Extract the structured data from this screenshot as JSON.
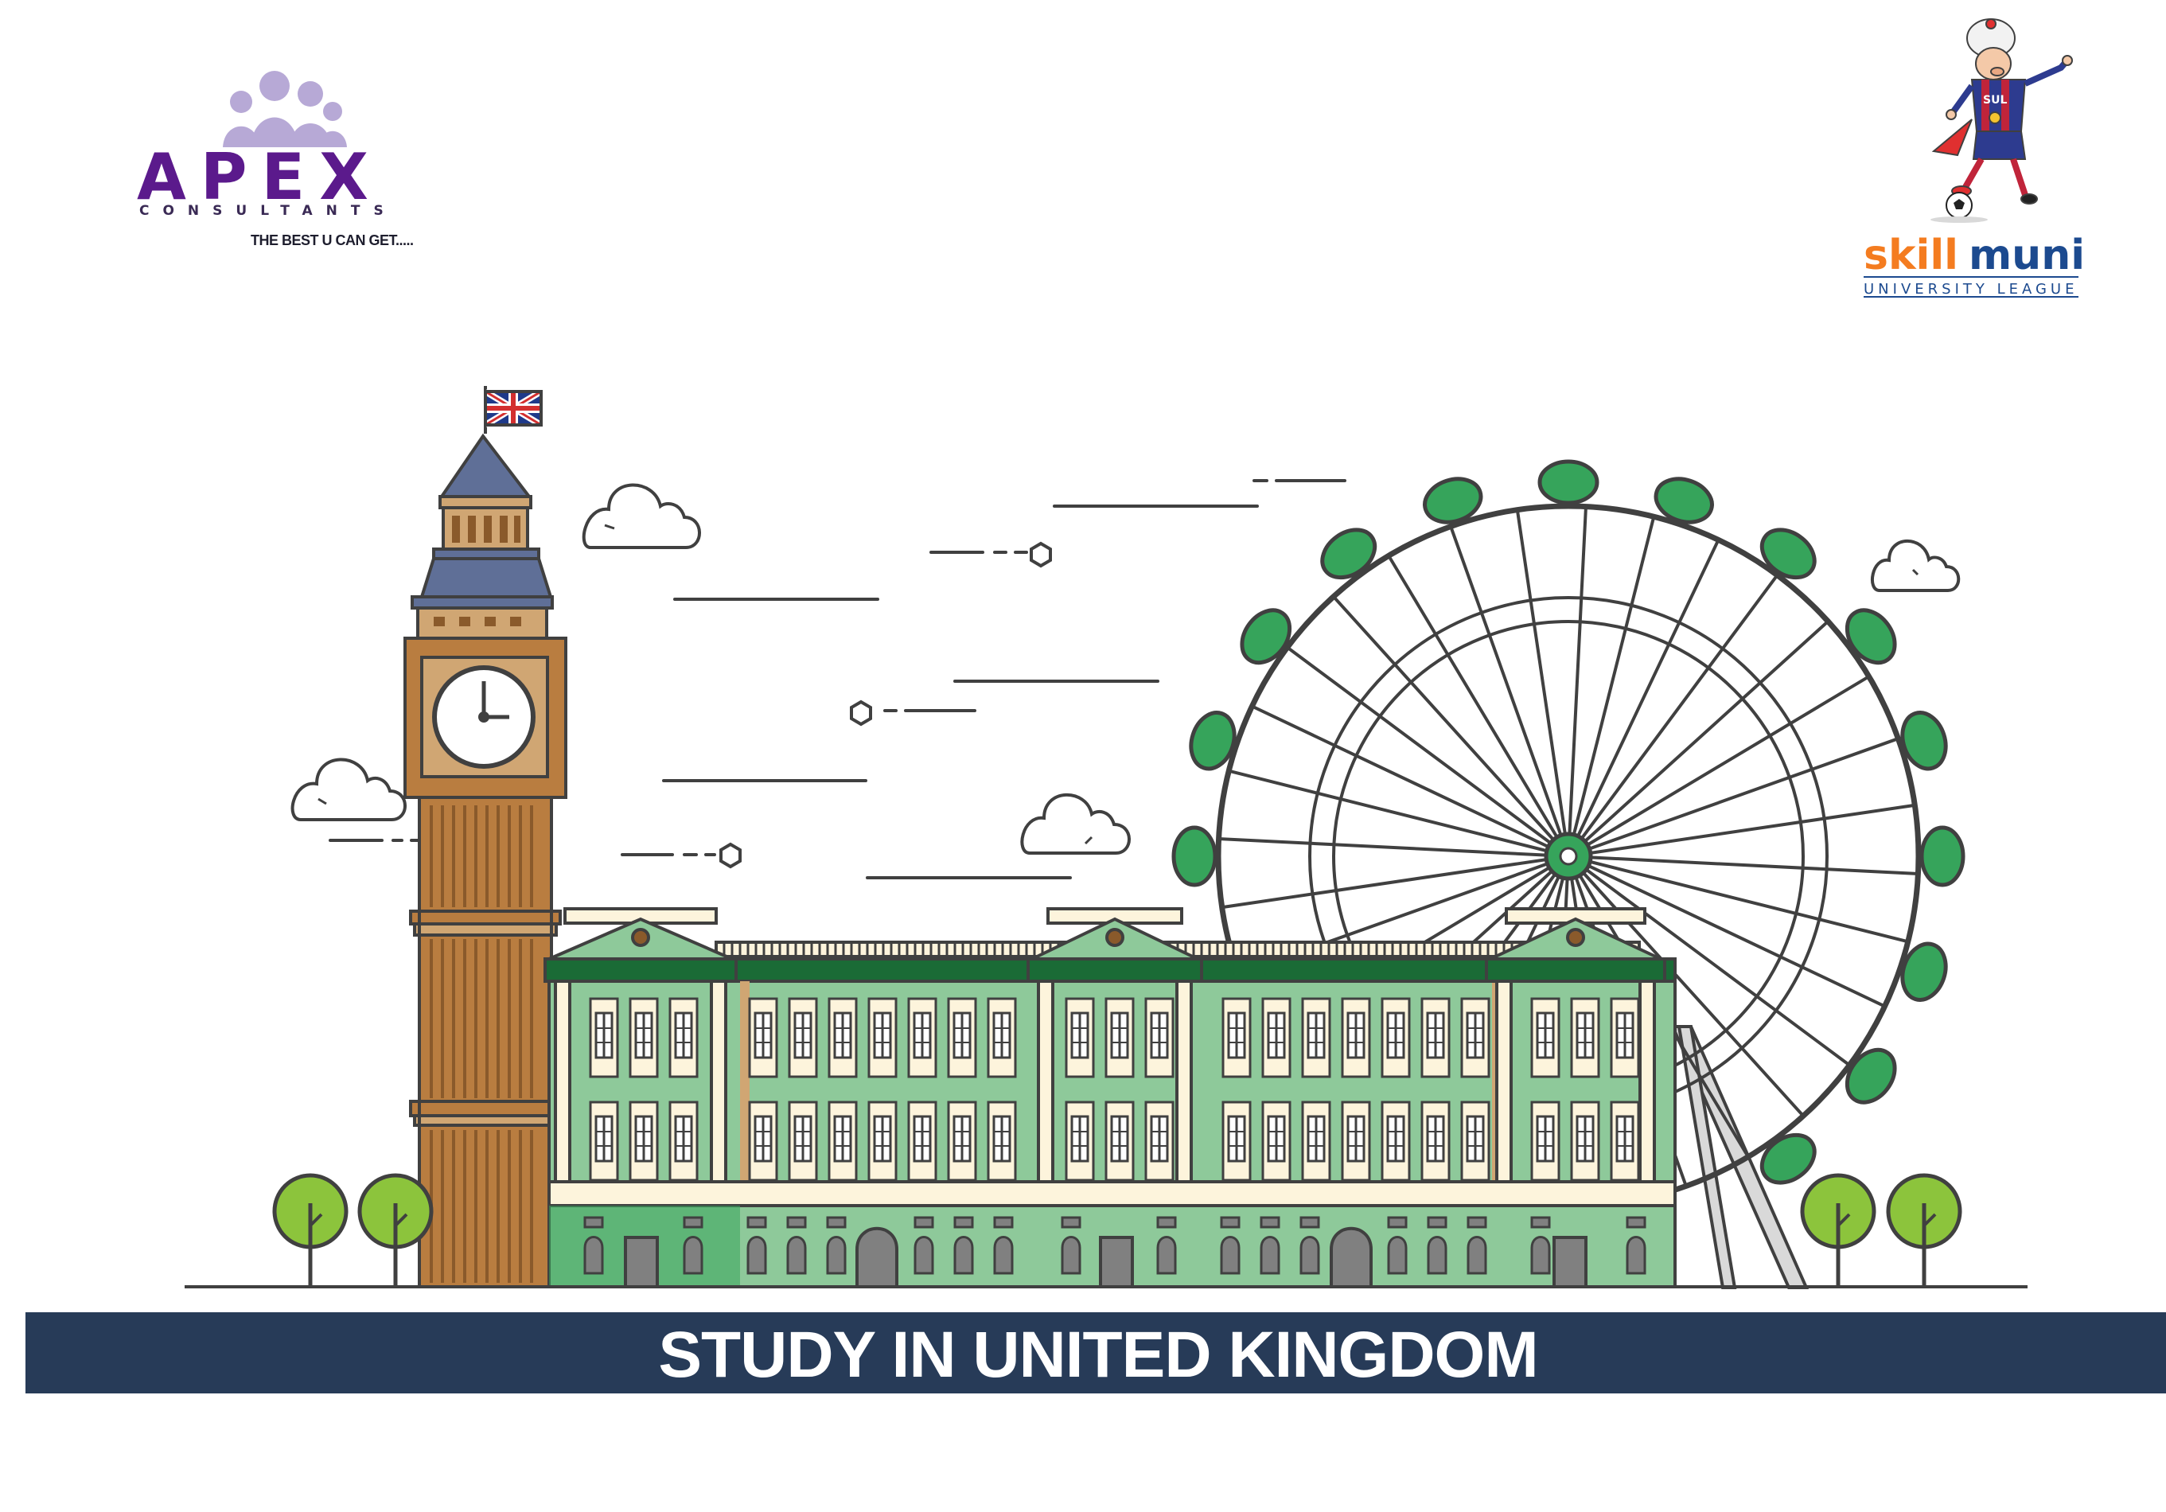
{
  "apex_logo": {
    "title": "APEX",
    "subtitle": "CONSULTANTS",
    "tagline": "THE BEST U CAN GET....."
  },
  "skillmuni_logo": {
    "brand_part1": "skill",
    "brand_part2": "muni",
    "subtitle": "UNIVERSITY LEAGUE",
    "shirt_text": "SUL"
  },
  "banner": {
    "text": "STUDY IN UNITED KINGDOM"
  },
  "colors": {
    "banner_bg": "#273b58",
    "outline": "#404040",
    "tower_brown": "#b97d40",
    "tower_dark": "#8a5a2b",
    "tower_tan": "#d0a673",
    "roof_slate": "#5f6f97",
    "palace_green": "#8ec99a",
    "palace_dark_green": "#1a6b36",
    "palace_cream": "#fdf4dc",
    "wheel_pod_green": "#36a45b",
    "tree_green": "#8cc43c",
    "apex_purple": "#5b1a8c",
    "skill_orange": "#f47c20",
    "muni_blue": "#1c4a8f"
  },
  "icons": [
    "union-jack-flag-icon",
    "clock-icon",
    "cloud-icon",
    "ferris-wheel-icon",
    "tree-icon",
    "mascot-icon",
    "soccer-ball-icon"
  ]
}
